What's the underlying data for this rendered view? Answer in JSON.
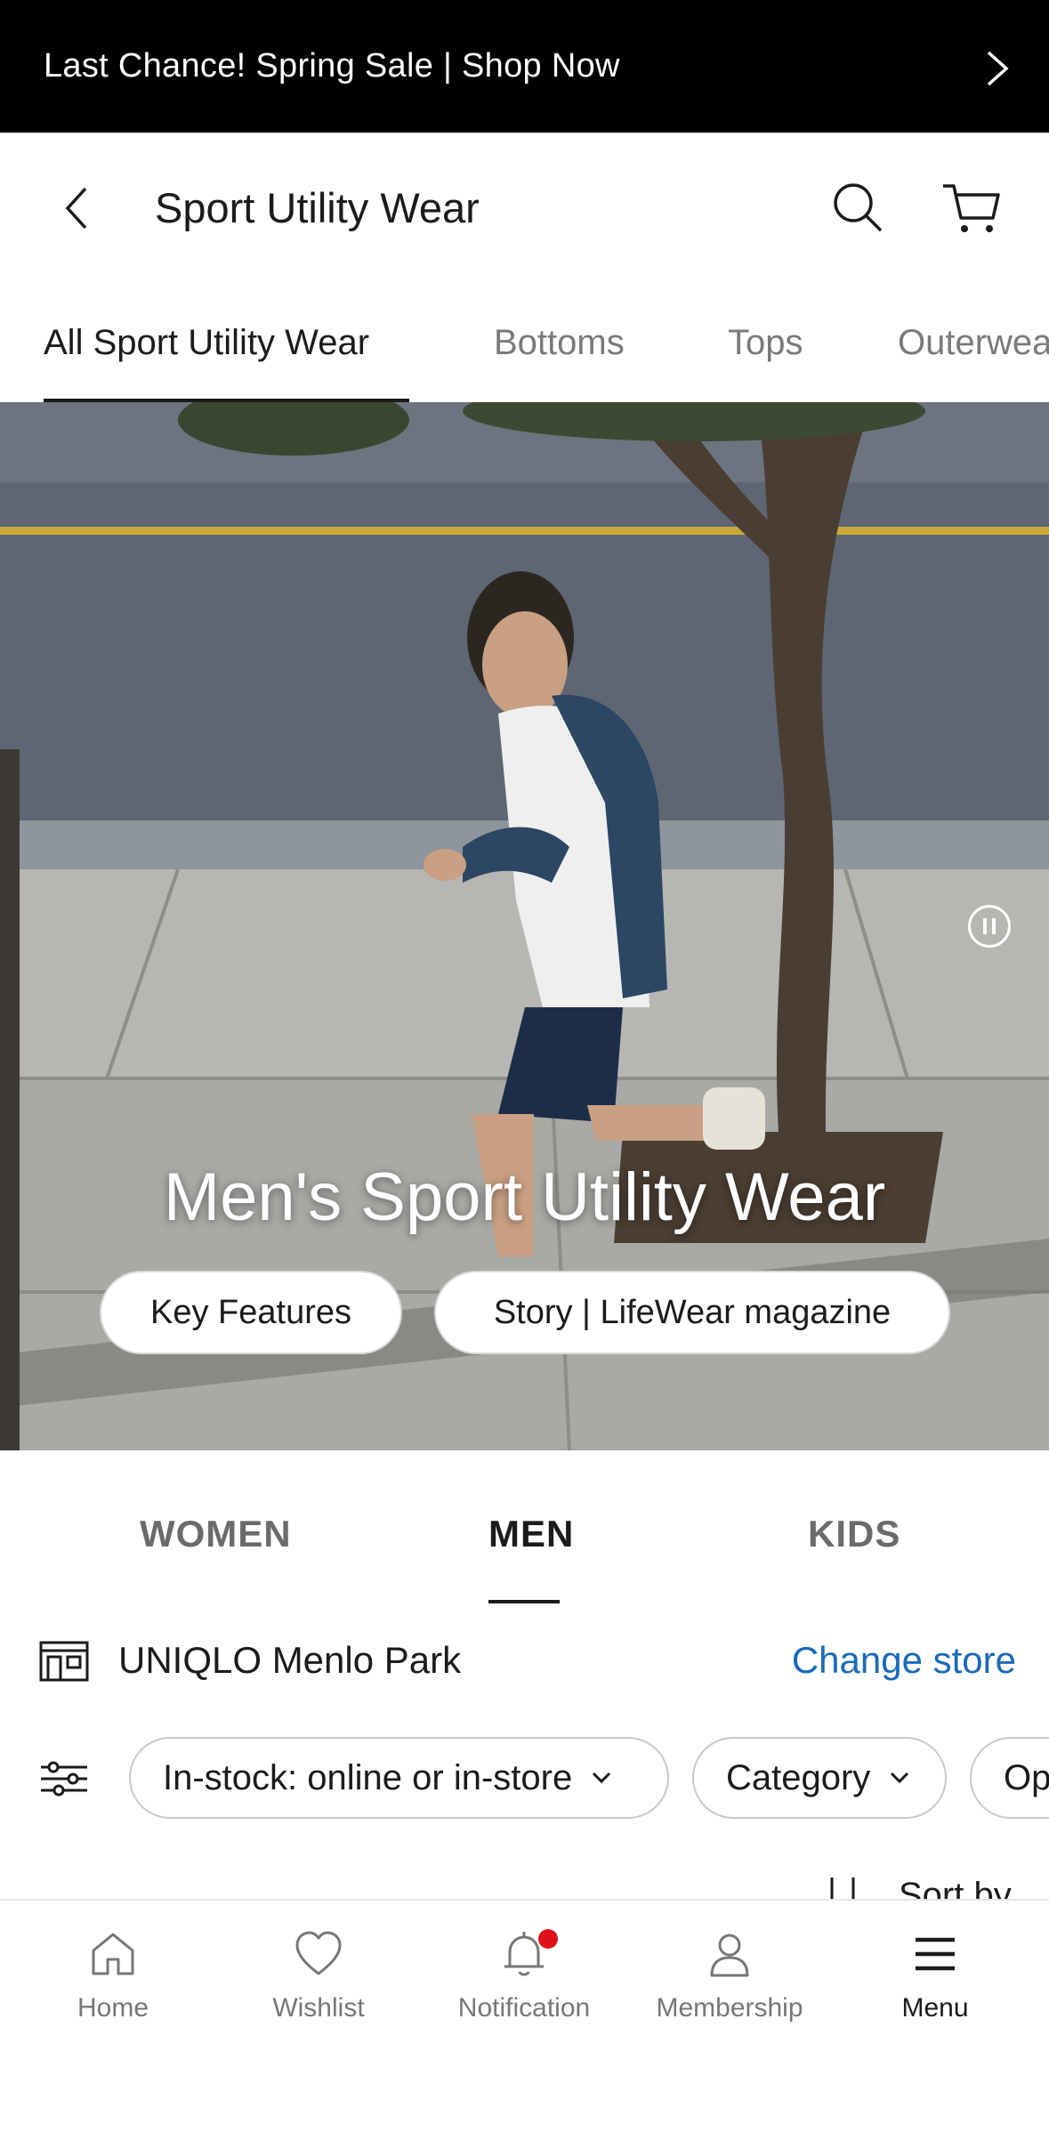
{
  "promo_banner": {
    "text": "Last Chance! Spring Sale | Shop Now",
    "icon": "chevron-right-icon"
  },
  "header": {
    "title": "Sport Utility Wear",
    "back_icon": "chevron-left-icon",
    "search_icon": "search-icon",
    "cart_icon": "cart-icon"
  },
  "category_tabs": [
    {
      "label": "All Sport Utility Wear",
      "active": true
    },
    {
      "label": "Bottoms",
      "active": false
    },
    {
      "label": "Tops",
      "active": false
    },
    {
      "label": "Outerwear",
      "active": false
    }
  ],
  "hero": {
    "title": "Men's Sport Utility Wear",
    "buttons": [
      "Key Features",
      "Story | LifeWear magazine"
    ],
    "pause_icon": "pause-icon"
  },
  "gender_tabs": [
    {
      "label": "WOMEN",
      "active": false
    },
    {
      "label": "MEN",
      "active": true
    },
    {
      "label": "KIDS",
      "active": false
    }
  ],
  "store": {
    "name": "UNIQLO Menlo Park",
    "change_label": "Change store",
    "icon": "store-icon"
  },
  "filters": {
    "icon": "filter-sliders-icon",
    "pills": [
      "In-stock: online or in-store",
      "Category",
      "Op"
    ]
  },
  "sort": {
    "label": "Sort by",
    "icon": "sort-icon"
  },
  "bottom_nav": [
    {
      "label": "Home",
      "icon": "home-icon",
      "active": false
    },
    {
      "label": "Wishlist",
      "icon": "heart-icon",
      "active": false
    },
    {
      "label": "Notification",
      "icon": "bell-icon",
      "active": false,
      "badge": true
    },
    {
      "label": "Membership",
      "icon": "person-icon",
      "active": false
    },
    {
      "label": "Menu",
      "icon": "menu-icon",
      "active": true
    }
  ],
  "colors": {
    "accent_link": "#1a6ab8",
    "badge": "#e0101a",
    "promo_bg": "#000000"
  }
}
